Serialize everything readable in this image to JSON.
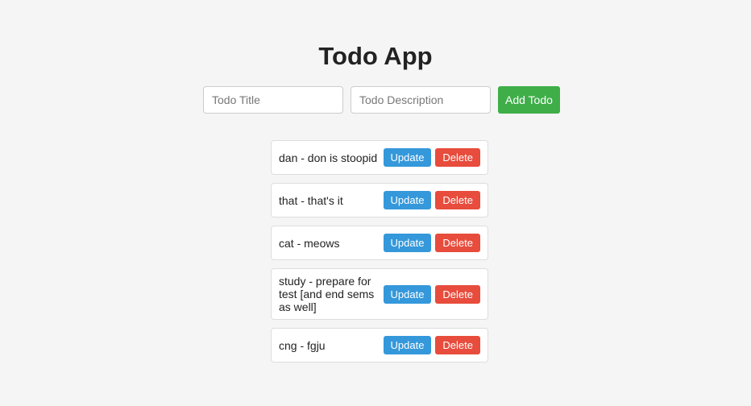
{
  "app": {
    "title": "Todo App"
  },
  "form": {
    "title_placeholder": "Todo Title",
    "description_placeholder": "Todo Description",
    "add_label": "Add Todo",
    "add_color": "#3fae49"
  },
  "todos": [
    {
      "text": "dan - don is stoopid",
      "update_label": "Update",
      "delete_label": "Delete"
    },
    {
      "text": "that - that's it",
      "update_label": "Update",
      "delete_label": "Delete"
    },
    {
      "text": "cat - meows",
      "update_label": "Update",
      "delete_label": "Delete"
    },
    {
      "text": "study - prepare for test [and end sems as well]",
      "update_label": "Update",
      "delete_label": "Delete"
    },
    {
      "text": "cng - fgju",
      "update_label": "Update",
      "delete_label": "Delete"
    }
  ],
  "colors": {
    "update": "#3498db",
    "delete": "#e74c3c"
  }
}
